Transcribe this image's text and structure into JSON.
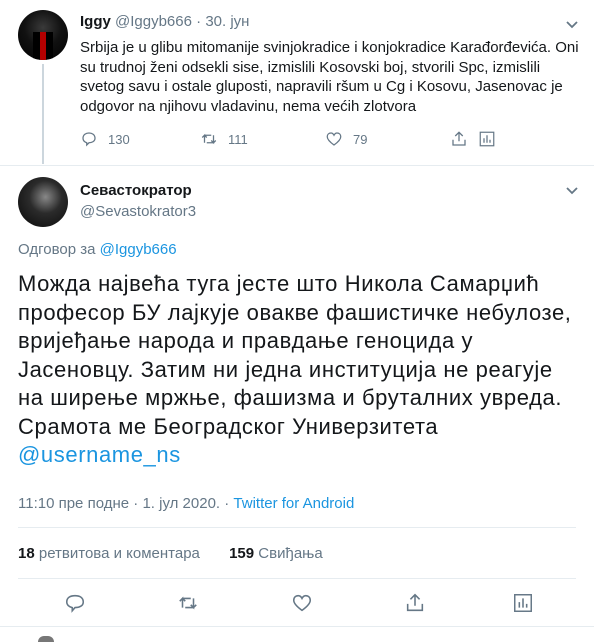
{
  "parent_tweet": {
    "display_name": "Iggy",
    "handle": "@Iggyb666",
    "separator": "·",
    "date": "30. јун",
    "text": "Srbija je u glibu mitomanije svinjokradice i konjokradice Karađorđevića. Oni su trudnoj ženi odsekli sise, izmislili Kosovski boj, stvorili Spc, izmislili svetog savu i ostale gluposti, napravili ršum u Cg i Kosovu, Jasenovac je odgovor na njihovu vladavinu, nema većih zlotvora",
    "replies": "130",
    "retweets": "111",
    "likes": "79",
    "icons": [
      "reply-icon",
      "retweet-icon",
      "like-icon",
      "share-icon",
      "analytics-icon",
      "chevron-down-icon"
    ]
  },
  "main_tweet": {
    "display_name": "Севастократор",
    "handle": "@Sevastokrator3",
    "reply_prefix": "Одговор за",
    "reply_to": "@Iggyb666",
    "text": "Можда највећа туга јесте што Никола Самарџић професор БУ лајкује овакве фашистичке небулозе, вријеђање народа  и правдање геноцида  у Јасеновцу. Затим ни једна институција не реагује на ширење мржње, фашизма и бруталних увреда. Срамота ме Београдског Универзитета",
    "mention": "@username_ns",
    "time": "11:10 пре подне",
    "separator": "·",
    "date": "1. јул 2020.",
    "client": "Twitter for Android",
    "retweets_count": "18",
    "retweets_label": "ретвитова и коментара",
    "likes_count": "159",
    "likes_label": "Свиђања",
    "icons": [
      "reply-icon",
      "retweet-icon",
      "like-icon",
      "share-icon",
      "analytics-icon",
      "chevron-down-icon"
    ]
  },
  "colors": {
    "text": "#14171a",
    "secondary": "#657786",
    "link": "#1b95e0",
    "divider": "#e6ecf0"
  }
}
